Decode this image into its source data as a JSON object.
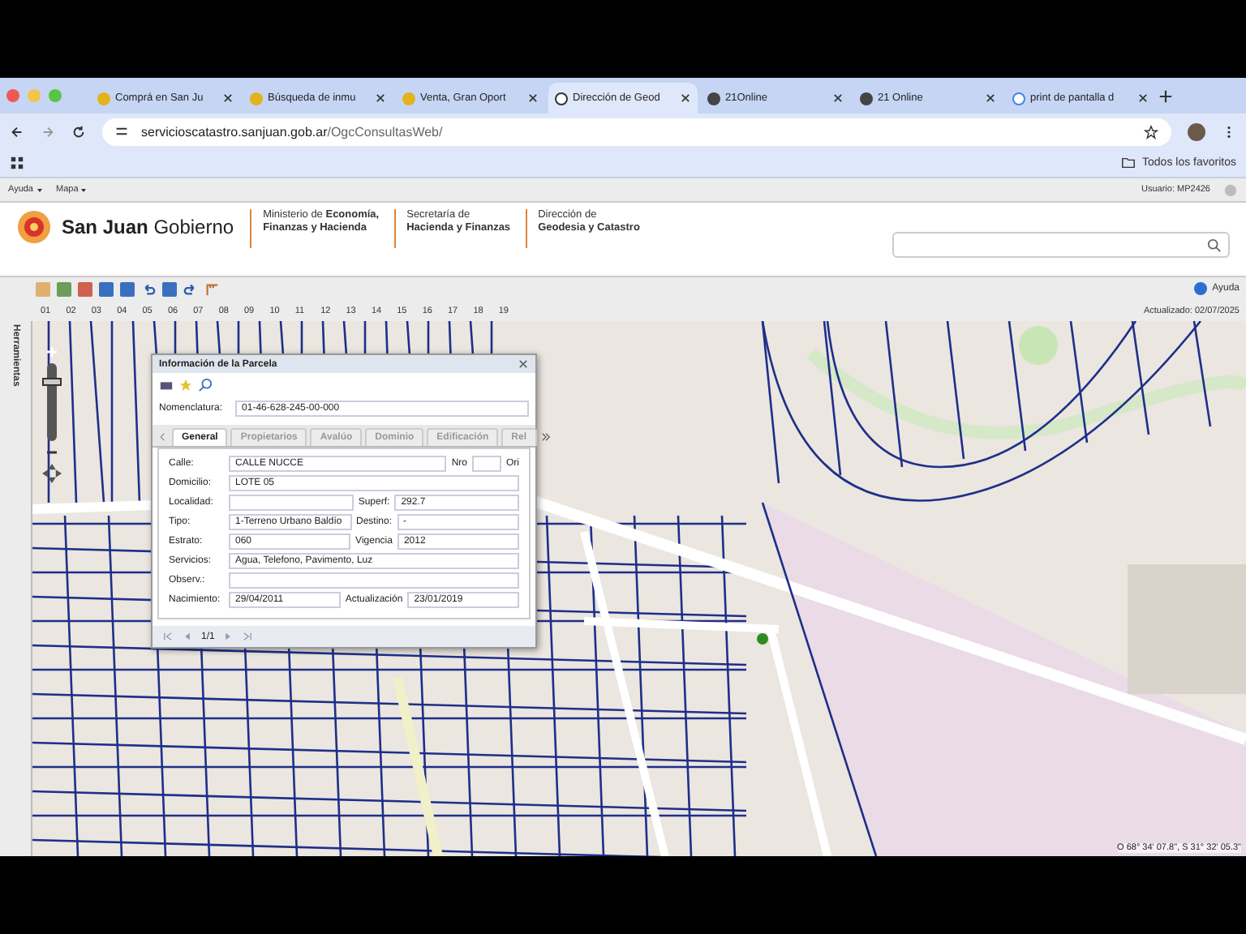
{
  "browser": {
    "tabs": [
      {
        "title": "Comprá en San Ju",
        "kind": "yellow",
        "selected": false
      },
      {
        "title": "Búsqueda de inmu",
        "kind": "yellow",
        "selected": false
      },
      {
        "title": "Venta, Gran Oport",
        "kind": "yellow",
        "selected": false
      },
      {
        "title": "Dirección de Geod",
        "kind": "globe",
        "selected": true
      },
      {
        "title": "21Online",
        "kind": "dark",
        "selected": false
      },
      {
        "title": "21 Online",
        "kind": "dark",
        "selected": false
      },
      {
        "title": "print de pantalla d",
        "kind": "google",
        "selected": false
      }
    ],
    "url_host": "servicioscatastro.sanjuan.gob.ar",
    "url_path": "/OgcConsultasWeb/",
    "bookmarks_label": "Todos los favoritos"
  },
  "menu": {
    "items": [
      "Ayuda",
      "Mapa"
    ],
    "user": "Usuario: MP2426"
  },
  "header": {
    "brand_bold": "San Juan",
    "brand_rest": "Gobierno",
    "blocks": [
      {
        "line1": "Ministerio de **Economía,**",
        "line2": "**Finanzas y Hacienda**"
      },
      {
        "line1": "Secretaría  de",
        "line2": "**Hacienda y Finanzas**"
      },
      {
        "line1": "Dirección de",
        "line2": "**Geodesia y Catastro**"
      }
    ]
  },
  "toolbar": {
    "help": "Ayuda",
    "layers": [
      "01",
      "02",
      "03",
      "04",
      "05",
      "06",
      "07",
      "08",
      "09",
      "10",
      "11",
      "12",
      "13",
      "14",
      "15",
      "16",
      "17",
      "18",
      "19"
    ],
    "updated": "Actualizado: 02/07/2025"
  },
  "sidebar": {
    "label": "Herramientas"
  },
  "map": {
    "zoom": {
      "level": 0.8
    },
    "coords": "O 68° 34' 07.8\", S 31° 32' 05.3\""
  },
  "parcel_popup": {
    "title": "Información de la Parcela",
    "nomenclature_label": "Nomenclatura:",
    "nomenclature": "01-46-628-245-00-000",
    "tabs": [
      {
        "label": "General",
        "selected": true
      },
      {
        "label": "Propietarios",
        "selected": false
      },
      {
        "label": "Avalúo",
        "selected": false
      },
      {
        "label": "Dominio",
        "selected": false
      },
      {
        "label": "Edificación",
        "selected": false
      },
      {
        "label": "Rel",
        "selected": false
      }
    ],
    "rows": [
      [
        {
          "label": "Calle:",
          "value": "CALLE NUCCE"
        },
        {
          "label": "Nro"
        },
        {
          "label": "Ori"
        }
      ],
      [
        {
          "label": "Domicilio:",
          "value": "LOTE 05"
        }
      ],
      [
        {
          "label": "Localidad:"
        },
        {
          "label": "Superf:",
          "value": "292.7"
        }
      ],
      [
        {
          "label": "Tipo:",
          "value": "1-Terreno Urbano Baldío"
        },
        {
          "label": "Destino:",
          "value": "-"
        }
      ],
      [
        {
          "label": "Estrato:",
          "value": "060"
        },
        {
          "label": "Vigencia",
          "value": "2012"
        }
      ],
      [
        {
          "label": "Servicios:",
          "value": "Agua, Telefono, Pavimento, Luz"
        }
      ],
      [
        {
          "label": "Observ.:"
        }
      ],
      [
        {
          "label": "Nacimiento:",
          "value": "29/04/2011"
        },
        {
          "label": "Actualización",
          "value": "23/01/2019"
        }
      ]
    ],
    "pager": "1/1"
  }
}
